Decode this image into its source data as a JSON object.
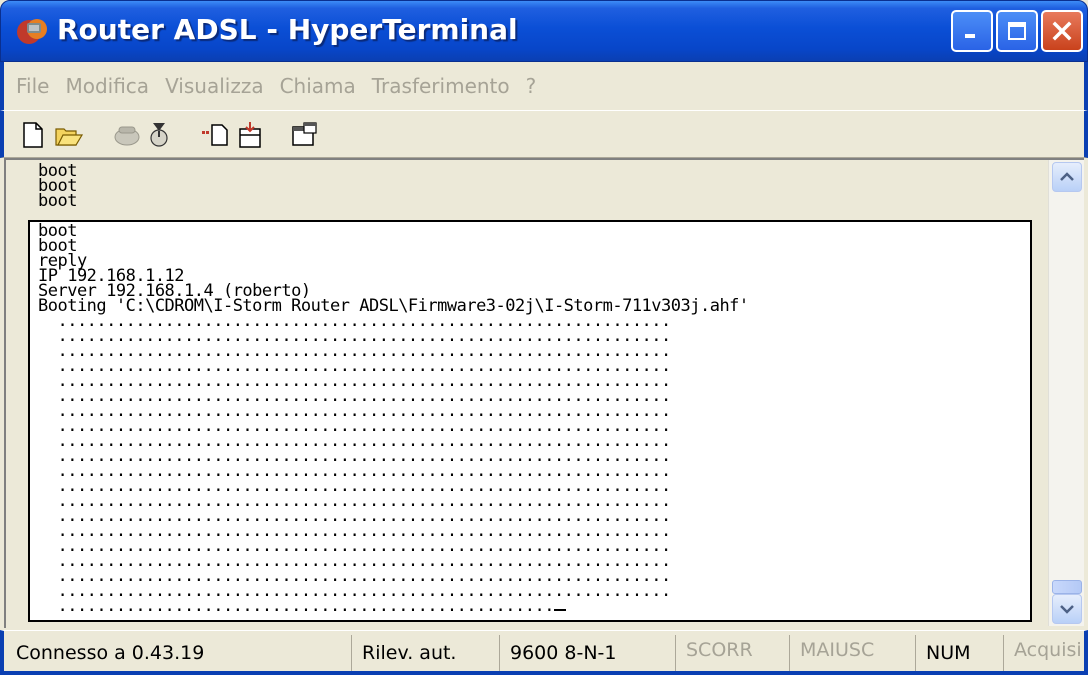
{
  "window": {
    "title": "Router ADSL - HyperTerminal"
  },
  "menu": [
    "File",
    "Modifica",
    "Visualizza",
    "Chiama",
    "Trasferimento",
    "?"
  ],
  "toolbar": {
    "icons": [
      "new-icon",
      "open-icon",
      "call-icon",
      "disconnect-icon",
      "send-icon",
      "receive-icon",
      "properties-icon"
    ]
  },
  "backscroll": {
    "lines": [
      "boot",
      "boot",
      "boot"
    ]
  },
  "terminal": {
    "lines": [
      "boot",
      "boot",
      "reply",
      "IP 192.168.1.12",
      "Server 192.168.1.4 (roberto)",
      "Booting 'C:\\CDROM\\I-Storm Router ADSL\\Firmware3-02j\\I-Storm-711v303j.ahf'",
      "  ...............................................................",
      "  ...............................................................",
      "  ...............................................................",
      "  ...............................................................",
      "  ...............................................................",
      "  ...............................................................",
      "  ...............................................................",
      "  ...............................................................",
      "  ...............................................................",
      "  ...............................................................",
      "  ...............................................................",
      "  ...............................................................",
      "  ...............................................................",
      "  ...............................................................",
      "  ...............................................................",
      "  ...............................................................",
      "  ...............................................................",
      "  ...............................................................",
      "  ...............................................................",
      "  ..................................................."
    ]
  },
  "status": {
    "connection": "Connesso a 0.43.19",
    "detect": "Rilev. aut.",
    "settings": "9600 8-N-1",
    "scroll": "SCORR",
    "caps": "MAIUSC",
    "num": "NUM",
    "capture": "Acquisi"
  },
  "colors": {
    "titlebar": "#0846c9",
    "window_bg": "#ece9d8",
    "terminal_bg": "#ffffff",
    "disabled_text": "#a6a396"
  }
}
